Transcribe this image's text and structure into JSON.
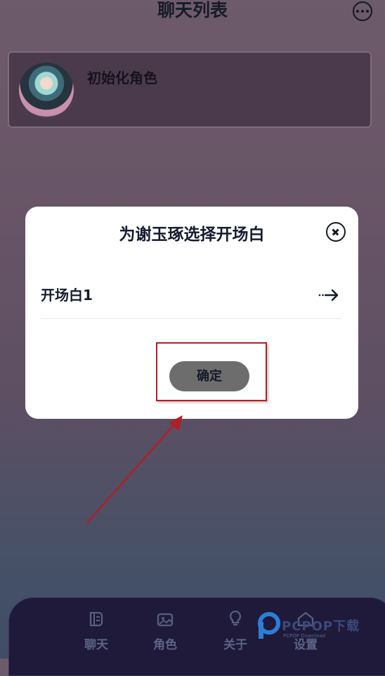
{
  "header": {
    "title": "聊天列表",
    "menu_icon": "more-horizontal-icon"
  },
  "chat_list": [
    {
      "name": "初始化角色",
      "avatar": "anime-character-avatar"
    }
  ],
  "modal": {
    "title": "为谢玉琢选择开场白",
    "close_icon": "close-circle-icon",
    "options": [
      {
        "label": "开场白1",
        "icon": "arrow-right-icon"
      }
    ],
    "confirm_label": "确定"
  },
  "tab_bar": {
    "tabs": [
      {
        "label": "聊天",
        "icon": "chat-icon"
      },
      {
        "label": "角色",
        "icon": "role-gallery-icon"
      },
      {
        "label": "关于",
        "icon": "lightbulb-icon"
      },
      {
        "label": "设置",
        "icon": "home-settings-icon"
      }
    ]
  },
  "watermark": {
    "brand": "PCPOP下载",
    "sub": "PCPOP Download"
  },
  "colors": {
    "annotation": "#b21f24",
    "modal_bg": "#ffffff",
    "confirm_bg": "#6d6d6d"
  }
}
